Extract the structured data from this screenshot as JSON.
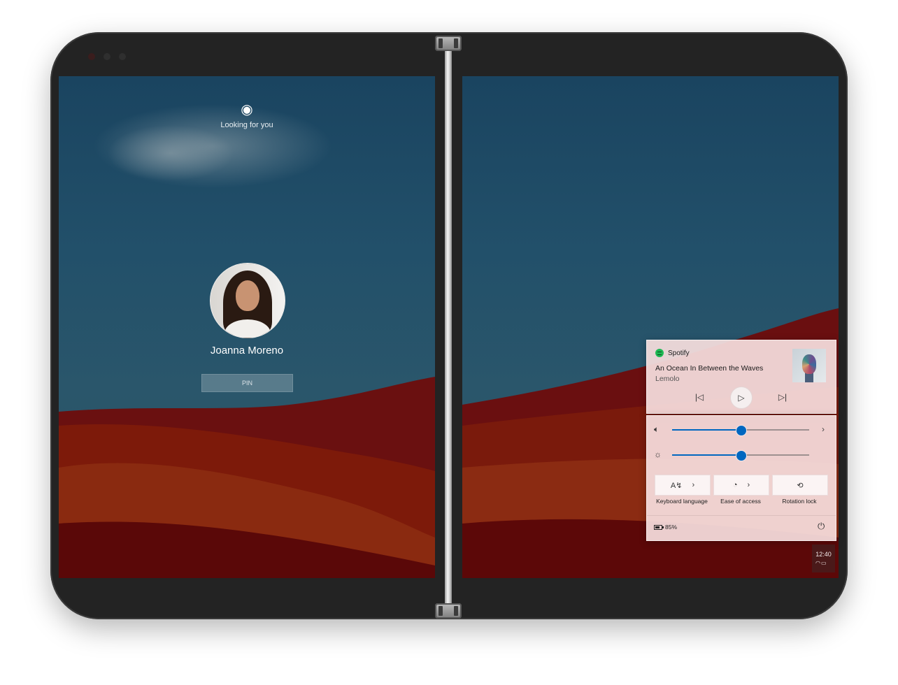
{
  "lock_screen": {
    "status_icon": "face-recognition-icon",
    "status_text": "Looking for you",
    "user_name": "Joanna Moreno",
    "pin_placeholder": "PIN"
  },
  "media": {
    "app_name": "Spotify",
    "track_title": "An Ocean In Between the Waves",
    "artist": "Lemolo",
    "controls": {
      "previous_icon": "previous-track-icon",
      "play_icon": "play-icon",
      "next_icon": "next-track-icon"
    }
  },
  "quick_settings": {
    "volume_level": 0.5,
    "brightness_level": 0.5,
    "tiles": [
      {
        "label": "Keyboard language",
        "icon": "keyboard-language-icon"
      },
      {
        "label": "Ease of access",
        "icon": "ease-of-access-icon"
      },
      {
        "label": "Rotation lock",
        "icon": "rotation-lock-icon"
      }
    ],
    "battery": "85%",
    "power_icon": "power-icon"
  },
  "taskbar": {
    "time": "12:40"
  },
  "colors": {
    "accent": "#0067c0",
    "spotify_green": "#1db954",
    "flyout_bg": "#f6dede"
  }
}
